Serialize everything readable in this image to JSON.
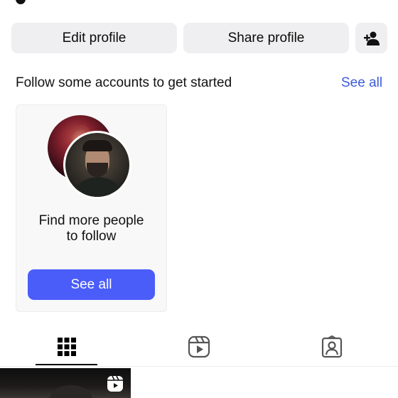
{
  "profile_actions": {
    "edit_label": "Edit profile",
    "share_label": "Share profile"
  },
  "suggestions": {
    "title": "Follow some accounts to get started",
    "see_all_link": "See all",
    "card": {
      "text_line1": "Find more people",
      "text_line2": "to follow",
      "button_label": "See all"
    }
  },
  "tabs": [
    {
      "name": "posts-grid",
      "icon": "grid-icon",
      "active": true
    },
    {
      "name": "reels",
      "icon": "reels-icon",
      "active": false
    },
    {
      "name": "tagged",
      "icon": "tagged-person-icon",
      "active": false
    }
  ],
  "colors": {
    "accent_blue": "#4a5df9",
    "link_blue": "#3b5bdb",
    "button_gray": "#efeff1"
  }
}
